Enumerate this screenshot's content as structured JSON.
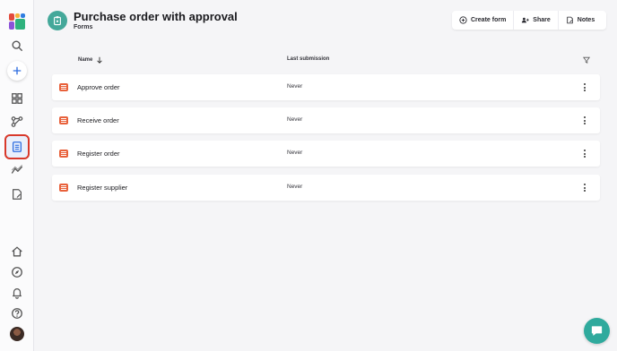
{
  "colors": {
    "accent_teal": "#44a89a",
    "form_icon": "#e8613b",
    "active_outline": "#d8392b",
    "chat_button": "#2faa9d"
  },
  "sidebar": {
    "items": [
      {
        "name": "search-icon"
      },
      {
        "name": "add-icon"
      },
      {
        "name": "dashboard-icon"
      },
      {
        "name": "workflow-icon"
      },
      {
        "name": "forms-icon",
        "active": true
      },
      {
        "name": "analytics-icon"
      },
      {
        "name": "notes-icon"
      },
      {
        "name": "home-icon"
      },
      {
        "name": "explore-icon"
      },
      {
        "name": "bell-icon"
      },
      {
        "name": "help-icon"
      },
      {
        "name": "avatar"
      }
    ]
  },
  "header": {
    "title": "Purchase order with approval",
    "subtitle": "Forms",
    "icon": "clipboard-icon"
  },
  "toolbar": {
    "create_form": "Create form",
    "share": "Share",
    "notes": "Notes"
  },
  "table": {
    "columns": {
      "name": "Name",
      "last_submission": "Last submission"
    },
    "sort": "name-descending",
    "rows": [
      {
        "name": "Approve order",
        "last_submission": "Never"
      },
      {
        "name": "Receive order",
        "last_submission": "Never"
      },
      {
        "name": "Register order",
        "last_submission": "Never"
      },
      {
        "name": "Register supplier",
        "last_submission": "Never"
      }
    ]
  }
}
